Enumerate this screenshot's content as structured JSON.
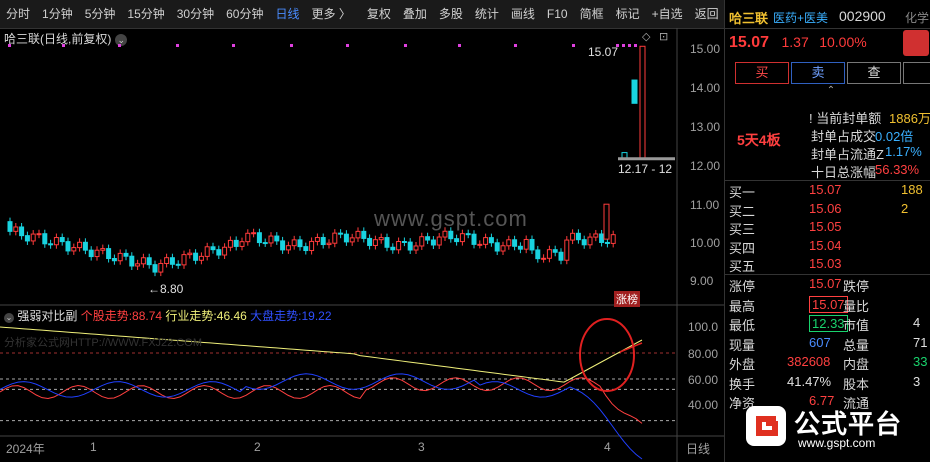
{
  "toolbar": {
    "items": [
      "分时",
      "1分钟",
      "5分钟",
      "15分钟",
      "30分钟",
      "60分钟",
      "日线",
      "更多 〉",
      "复权",
      "叠加",
      "多股",
      "统计",
      "画线",
      "F10",
      "简框",
      "标记",
      "+自选",
      "返回"
    ],
    "active_index": 6
  },
  "chart": {
    "title": "哈三联(日线,前复权)",
    "y_ticks": [
      "15.00",
      "14.00",
      "13.00",
      "12.00",
      "11.00",
      "10.00",
      "9.00"
    ],
    "high_label": "15.07",
    "low_label": "8.80",
    "range_label": "12.17 - 12",
    "limit_badge": "涨榜",
    "watermark": "www.gspt.com"
  },
  "indicator": {
    "name": "强弱对比副",
    "s1_label": "个股走势:",
    "s1_value": "88.74",
    "s2_label": "行业走势:",
    "s2_value": "46.46",
    "s3_label": "大盘走势:",
    "s3_value": "19.22",
    "faint_text": "分析家公式网HTTP://WWW.FXJ22.COM",
    "y_ticks": [
      "100.0",
      "80.00",
      "60.00",
      "40.00"
    ]
  },
  "x_axis": [
    "2024年",
    "1",
    "2",
    "3",
    "4",
    "日线"
  ],
  "colors": {
    "up": "#ff3b3b",
    "down": "#19d3e0",
    "s1": "#f0f07a",
    "s2": "#ff4040",
    "s3": "#2040ff"
  },
  "quote": {
    "name": "哈三联",
    "tags": "医药+医美",
    "code": "002900",
    "extra": "化学",
    "price": "15.07",
    "change": "1.37",
    "pct": "10.00%",
    "buy": "买",
    "sell": "卖",
    "query": "查",
    "board": "5天4板",
    "seal_amt_label": "当前封单额",
    "seal_amt": "1886万",
    "seal_ratio_label": "封单占成交",
    "seal_ratio": "0.02倍",
    "seal_float_label": "封单占流通Z",
    "seal_float": "1.17%",
    "ten_day_label": "十日总涨幅",
    "ten_day": "56.33%",
    "bids": [
      {
        "label": "买一",
        "price": "15.07",
        "vol": "188"
      },
      {
        "label": "买二",
        "price": "15.06",
        "vol": "2"
      },
      {
        "label": "买三",
        "price": "15.05",
        "vol": ""
      },
      {
        "label": "买四",
        "price": "15.04",
        "vol": ""
      },
      {
        "label": "买五",
        "price": "15.03",
        "vol": ""
      }
    ],
    "stats": [
      {
        "l1": "涨停",
        "v1": "15.07",
        "l2": "跌停",
        "v2": ""
      },
      {
        "l1": "最高",
        "v1": "15.07",
        "l2": "量比",
        "v2": ""
      },
      {
        "l1": "最低",
        "v1": "12.33",
        "l2": "市值",
        "v2": "4"
      },
      {
        "l1": "现量",
        "v1": "607",
        "l2": "总量",
        "v2": "71"
      },
      {
        "l1": "外盘",
        "v1": "382608",
        "l2": "内盘",
        "v2": "33"
      },
      {
        "l1": "换手",
        "v1": "41.47%",
        "l2": "股本",
        "v2": "3"
      },
      {
        "l1": "净资",
        "v1": "6.77",
        "l2": "流通",
        "v2": ""
      }
    ],
    "brand": "公式平台",
    "brand_url": "www.gspt.com"
  }
}
